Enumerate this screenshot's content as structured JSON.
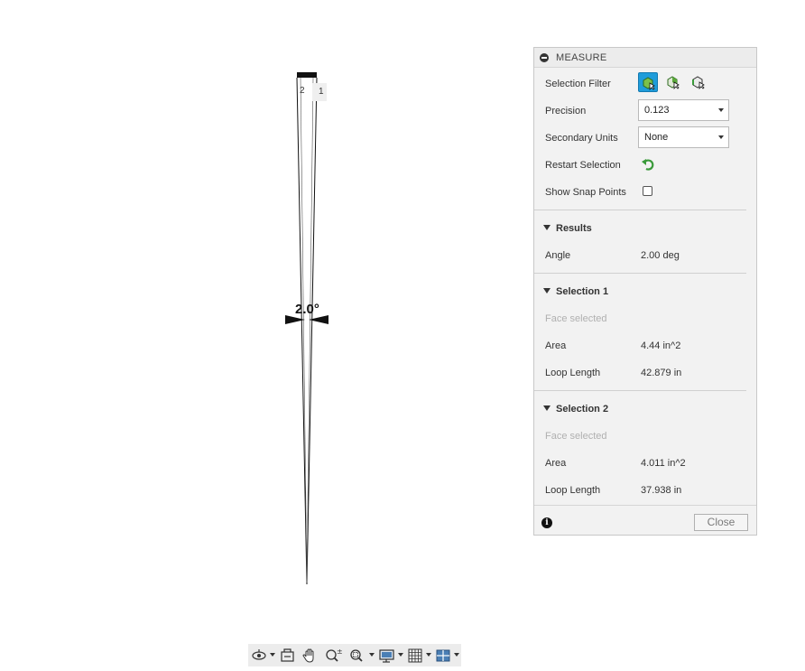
{
  "viewport": {
    "angle_annotation": "2.0°",
    "face_labels": [
      "2",
      "1"
    ]
  },
  "measure_panel": {
    "title": "MEASURE",
    "selection_filter_label": "Selection Filter",
    "selection_filter_icons": [
      "select-body-icon",
      "select-face-icon",
      "select-edge-icon"
    ],
    "precision_label": "Precision",
    "precision_value": "0.123",
    "secondary_units_label": "Secondary Units",
    "secondary_units_value": "None",
    "restart_selection_label": "Restart Selection",
    "show_snap_points_label": "Show Snap Points",
    "show_snap_points_checked": false,
    "results": {
      "header": "Results",
      "angle_label": "Angle",
      "angle_value": "2.00 deg"
    },
    "selection1": {
      "header": "Selection 1",
      "status": "Face selected",
      "area_label": "Area",
      "area_value": "4.44 in^2",
      "loop_label": "Loop Length",
      "loop_value": "42.879 in"
    },
    "selection2": {
      "header": "Selection 2",
      "status": "Face selected",
      "area_label": "Area",
      "area_value": "4.011 in^2",
      "loop_label": "Loop Length",
      "loop_value": "37.938 in"
    },
    "close_label": "Close"
  },
  "toolbar": {
    "icons": [
      "orbit-icon",
      "look-at-icon",
      "pan-icon",
      "zoom-icon",
      "fit-icon",
      "display-settings-icon",
      "grid-icon",
      "viewports-icon"
    ]
  },
  "colors": {
    "accent": "#1f9cda",
    "panel_bg": "#f2f2f2",
    "green_icon": "#3a9a3a"
  }
}
